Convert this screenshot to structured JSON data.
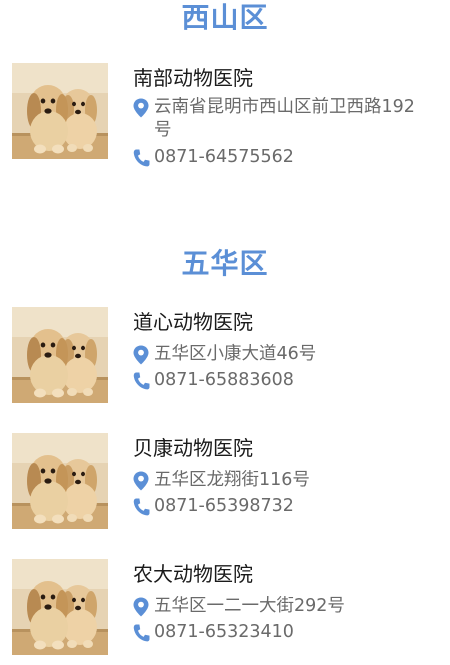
{
  "colors": {
    "accent": "#5b8fd6",
    "text_primary": "#1a1a1a",
    "text_secondary": "#6a6a6a"
  },
  "sections": [
    {
      "title": "西山区",
      "clinics": [
        {
          "name": "南部动物医院",
          "address_icon": "location-pin-icon",
          "address": "云南省昆明市西山区前卫西路192号",
          "phone_icon": "phone-icon",
          "phone": "0871-64575562",
          "image": "puppies-photo"
        }
      ]
    },
    {
      "title": "五华区",
      "clinics": [
        {
          "name": "道心动物医院",
          "address_icon": "location-pin-icon",
          "address": "五华区小康大道46号",
          "phone_icon": "phone-icon",
          "phone": "0871-65883608",
          "image": "puppies-photo"
        },
        {
          "name": "贝康动物医院",
          "address_icon": "location-pin-icon",
          "address": "五华区龙翔街116号",
          "phone_icon": "phone-icon",
          "phone": "0871-65398732",
          "image": "puppies-photo"
        },
        {
          "name": "农大动物医院",
          "address_icon": "location-pin-icon",
          "address": "五华区一二一大街292号",
          "phone_icon": "phone-icon",
          "phone": "0871-65323410",
          "image": "puppies-photo"
        }
      ]
    }
  ]
}
